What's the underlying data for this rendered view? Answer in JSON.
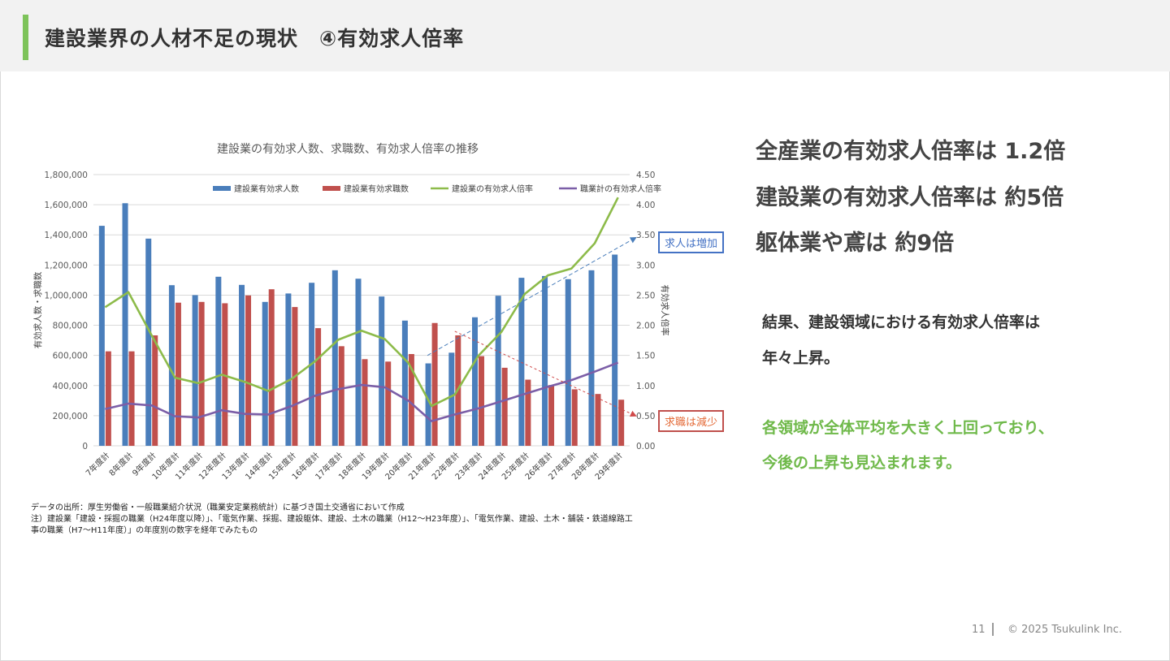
{
  "header": {
    "title": "建設業界の人材不足の現状　④有効求人倍率"
  },
  "colors": {
    "accent": "#7dc35a",
    "blue": "#4a7ebb",
    "red": "#c0504d",
    "green": "#8dbb4a",
    "purple": "#7b5ea7"
  },
  "chart_data": {
    "type": "bar",
    "title": "建設業の有効求人数、求職数、有効求人倍率の推移",
    "ylabel": "有効求人数・求職数",
    "y2label": "有効求人倍率",
    "ylim": [
      0,
      1800000
    ],
    "y2lim": [
      0,
      4.5
    ],
    "yticks": [
      "0",
      "200,000",
      "400,000",
      "600,000",
      "800,000",
      "1,000,000",
      "1,200,000",
      "1,400,000",
      "1,600,000",
      "1,800,000"
    ],
    "y2ticks": [
      "0.00",
      "0.50",
      "1.00",
      "1.50",
      "2.00",
      "2.50",
      "3.00",
      "3.50",
      "4.00",
      "4.50"
    ],
    "legend_position": "top",
    "categories": [
      "7年度計",
      "8年度計",
      "9年度計",
      "10年度計",
      "11年度計",
      "12年度計",
      "13年度計",
      "14年度計",
      "15年度計",
      "16年度計",
      "17年度計",
      "18年度計",
      "19年度計",
      "20年度計",
      "21年度計",
      "22年度計",
      "23年度計",
      "24年度計",
      "25年度計",
      "26年度計",
      "27年度計",
      "28年度計",
      "29年度計"
    ],
    "series": [
      {
        "name": "建設業有効求人数",
        "type": "bar",
        "axis": "left",
        "color": "#4a7ebb",
        "values": [
          1460000,
          1610000,
          1375000,
          1066000,
          1000000,
          1122000,
          1068000,
          955000,
          1011000,
          1082000,
          1165000,
          1109000,
          991000,
          831000,
          547000,
          618000,
          853000,
          996000,
          1115000,
          1127000,
          1106000,
          1165000,
          1269000
        ]
      },
      {
        "name": "建設業有効求職数",
        "type": "bar",
        "axis": "left",
        "color": "#c0504d",
        "values": [
          627000,
          627000,
          733000,
          950000,
          955000,
          946000,
          998000,
          1039000,
          921000,
          781000,
          661000,
          575000,
          559000,
          609000,
          815000,
          733000,
          595000,
          518000,
          439000,
          403000,
          375000,
          344000,
          306000
        ]
      },
      {
        "name": "建設業の有効求人倍率",
        "type": "line",
        "axis": "right",
        "color": "#8dbb4a",
        "values": [
          2.3,
          2.55,
          1.83,
          1.13,
          1.04,
          1.18,
          1.06,
          0.91,
          1.11,
          1.4,
          1.76,
          1.91,
          1.77,
          1.38,
          0.66,
          0.85,
          1.49,
          1.89,
          2.52,
          2.83,
          2.94,
          3.36,
          4.12
        ]
      },
      {
        "name": "職業計の有効求人倍率",
        "type": "line",
        "axis": "right",
        "color": "#7b5ea7",
        "values": [
          0.61,
          0.7,
          0.67,
          0.49,
          0.47,
          0.59,
          0.53,
          0.52,
          0.66,
          0.83,
          0.94,
          1.01,
          0.97,
          0.75,
          0.41,
          0.52,
          0.62,
          0.74,
          0.86,
          0.98,
          1.09,
          1.23,
          1.38
        ]
      }
    ],
    "annotations": [
      {
        "text": "求人は増加",
        "color": "#4472c4"
      },
      {
        "text": "求職は減少",
        "color": "#e46c3a"
      }
    ]
  },
  "notes": [
    "データの出所：厚生労働省・一般職業紹介状況（職業安定業務統計）に基づき国土交通省において作成",
    "注）建設業「建設・採掘の職業（H24年度以降）」、「電気作業、採掘、建設躯体、建設、土木の職業（H12〜H23年度）」、「電気作業、建設、土木・舗装・鉄道線路工",
    "事の職業（H7〜H11年度）」の年度別の数字を経年でみたもの"
  ],
  "right": {
    "headline1": "全産業の有効求人倍率は 1.2倍",
    "headline2": "建設業の有効求人倍率は 約5倍",
    "headline3": "躯体業や鳶は 約9倍",
    "body1": "結果、建設領域における有効求人倍率は",
    "body2": "年々上昇。",
    "green1": "各領域が全体平均を大きく上回っており、",
    "green2": "今後の上昇も見込まれます。"
  },
  "footer": {
    "page": "11",
    "copyright": "© 2025 Tsukulink Inc."
  }
}
